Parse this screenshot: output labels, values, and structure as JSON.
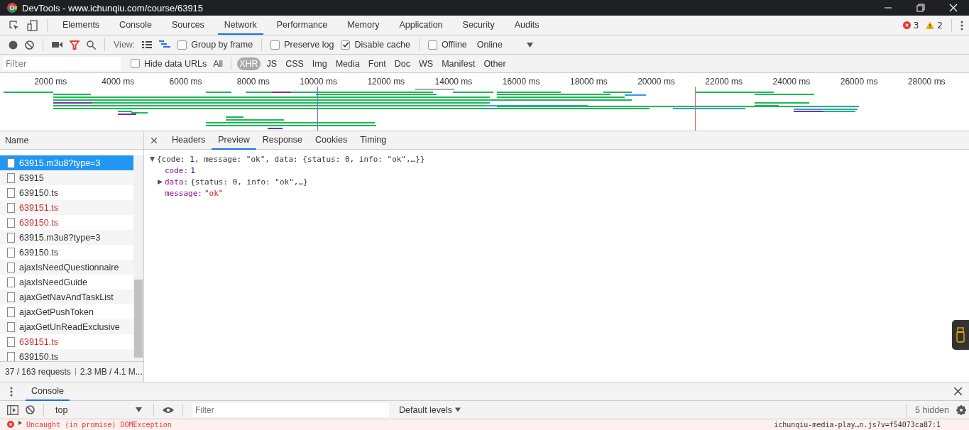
{
  "window": {
    "title": "DevTools - www.ichunqiu.com/course/63915"
  },
  "panel_tabs": [
    {
      "label": "Elements",
      "selected": false
    },
    {
      "label": "Console",
      "selected": false
    },
    {
      "label": "Sources",
      "selected": false
    },
    {
      "label": "Network",
      "selected": true
    },
    {
      "label": "Performance",
      "selected": false
    },
    {
      "label": "Memory",
      "selected": false
    },
    {
      "label": "Application",
      "selected": false
    },
    {
      "label": "Security",
      "selected": false
    },
    {
      "label": "Audits",
      "selected": false
    }
  ],
  "issue_counts": {
    "errors": "3",
    "warnings": "2"
  },
  "toolbar": {
    "recording": true,
    "filter_active": true,
    "view_label": "View:",
    "options": [
      {
        "label": "Group by frame",
        "checked": false
      },
      {
        "label": "Preserve log",
        "checked": false
      },
      {
        "label": "Disable cache",
        "checked": true
      },
      {
        "label": "Offline",
        "checked": false
      }
    ],
    "throttling": "Online"
  },
  "filter_bar": {
    "placeholder": "Filter",
    "hide_data_urls": {
      "label": "Hide data URLs",
      "checked": false
    },
    "types": [
      {
        "label": "All",
        "selected": false
      },
      {
        "label": "XHR",
        "selected": true
      },
      {
        "label": "JS",
        "selected": false
      },
      {
        "label": "CSS",
        "selected": false
      },
      {
        "label": "Img",
        "selected": false
      },
      {
        "label": "Media",
        "selected": false
      },
      {
        "label": "Font",
        "selected": false
      },
      {
        "label": "Doc",
        "selected": false
      },
      {
        "label": "WS",
        "selected": false
      },
      {
        "label": "Manifest",
        "selected": false
      },
      {
        "label": "Other",
        "selected": false
      }
    ]
  },
  "timeline": {
    "ticks": [
      "2000 ms",
      "4000 ms",
      "6000 ms",
      "8000 ms",
      "10000 ms",
      "12000 ms",
      "14000 ms",
      "16000 ms",
      "18000 ms",
      "20000 ms",
      "22000 ms",
      "24000 ms",
      "26000 ms",
      "28000 ms"
    ]
  },
  "requests": {
    "header": "Name",
    "rows": [
      {
        "name": "63915.m3u8?type=3",
        "failed": false,
        "selected": true
      },
      {
        "name": "63915",
        "failed": false,
        "selected": false
      },
      {
        "name": "639150.ts",
        "failed": false,
        "selected": false
      },
      {
        "name": "639151.ts",
        "failed": true,
        "selected": false
      },
      {
        "name": "639150.ts",
        "failed": true,
        "selected": false
      },
      {
        "name": "63915.m3u8?type=3",
        "failed": false,
        "selected": false
      },
      {
        "name": "639150.ts",
        "failed": false,
        "selected": false
      },
      {
        "name": "ajaxIsNeedQuestionnaire",
        "failed": false,
        "selected": false
      },
      {
        "name": "ajaxIsNeedGuide",
        "failed": false,
        "selected": false
      },
      {
        "name": "ajaxGetNavAndTaskList",
        "failed": false,
        "selected": false
      },
      {
        "name": "ajaxGetPushToken",
        "failed": false,
        "selected": false
      },
      {
        "name": "ajaxGetUnReadExclusive",
        "failed": false,
        "selected": false
      },
      {
        "name": "639151.ts",
        "failed": true,
        "selected": false
      },
      {
        "name": "639150.ts",
        "failed": false,
        "selected": false
      }
    ],
    "summary": "37 / 163 requests",
    "transfer": "2.3 MB / 4.1 M..."
  },
  "detail": {
    "tabs": [
      {
        "label": "Headers",
        "selected": false
      },
      {
        "label": "Preview",
        "selected": true
      },
      {
        "label": "Response",
        "selected": false
      },
      {
        "label": "Cookies",
        "selected": false
      },
      {
        "label": "Timing",
        "selected": false
      }
    ],
    "preview": {
      "summary": "{code: 1, message: \"ok\", data: {status: 0, info: \"ok\",…}}",
      "expanded": true,
      "fields": [
        {
          "key": "code:",
          "value": "1",
          "kind": "number"
        },
        {
          "key": "data:",
          "value": "{status: 0, info: \"ok\",…}",
          "kind": "object"
        },
        {
          "key": "message:",
          "value": "\"ok\"",
          "kind": "string"
        }
      ]
    }
  },
  "drawer": {
    "tab": "Console",
    "context": "top",
    "filter_placeholder": "Filter",
    "levels": "Default levels",
    "hidden": "5 hidden",
    "messages": [
      {
        "text": "Uncaught (in promise) DOMException",
        "source": "ichunqiu-media-play…n.js?v=f54073ca87:1"
      }
    ]
  }
}
